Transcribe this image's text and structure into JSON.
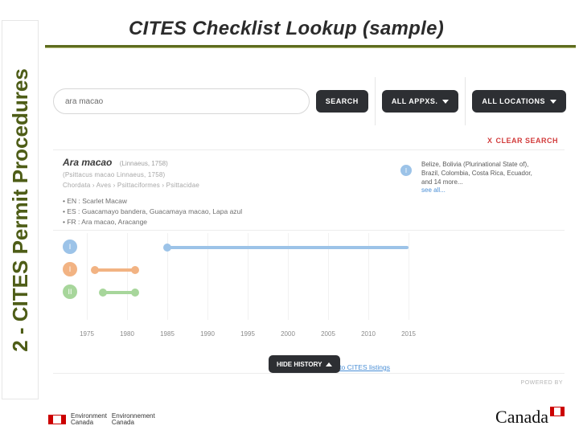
{
  "side_tab": {
    "label": "2 - CITES Permit Procedures"
  },
  "title": "CITES Checklist Lookup (sample)",
  "filters": {
    "search_value": "ara macao",
    "search_btn": "SEARCH",
    "appx_btn": "ALL APPXS.",
    "loc_btn": "ALL LOCATIONS",
    "clear": "CLEAR SEARCH"
  },
  "species": {
    "name": "Ara macao",
    "authority": "(Linnaeus, 1758)",
    "spp_label": "(Psittacus macao Linnaeus, 1758)",
    "taxonomy": "Chordata  ›  Aves  ›  Psittaciformes  ›  Psittacidae",
    "cn": [
      "EN : Scarlet Macaw",
      "ES : Guacamayo bandera, Guacamaya macao, Lapa azul",
      "FR : Ara macao, Aracange"
    ]
  },
  "distribution": {
    "badge": "I",
    "text_line1": "Belize, Bolivia (Plurinational State of),",
    "text_line2": "Brazil, Colombia, Costa Rica, Ecuador,",
    "text_line3": "and 14 more...",
    "see_all": "see all..."
  },
  "chart_data": {
    "type": "timeline",
    "x_years": [
      1975,
      1980,
      1985,
      1990,
      1995,
      2000,
      2005,
      2010,
      2015
    ],
    "x_range": [
      1975,
      2015
    ],
    "rows": [
      {
        "badge": "I",
        "color": "blue",
        "segments": [
          {
            "start": 1985,
            "end": 2015
          }
        ],
        "dots": [
          1985
        ]
      },
      {
        "badge": "I",
        "color": "orange",
        "segments": [
          {
            "start": 1976,
            "end": 1981
          }
        ],
        "dots": [
          1976,
          1981
        ]
      },
      {
        "badge": "II",
        "color": "green",
        "segments": [
          {
            "start": 1977,
            "end": 1981
          }
        ],
        "dots": [
          1977,
          1981
        ]
      }
    ]
  },
  "links": {
    "reservations": "See reservations to CITES listings",
    "hide_history": "HIDE HISTORY",
    "powered": "POWERED BY"
  },
  "footer": {
    "dept_en": "Environment",
    "dept_en2": "Canada",
    "dept_fr": "Environnement",
    "dept_fr2": "Canada",
    "wordmark": "Canada"
  }
}
